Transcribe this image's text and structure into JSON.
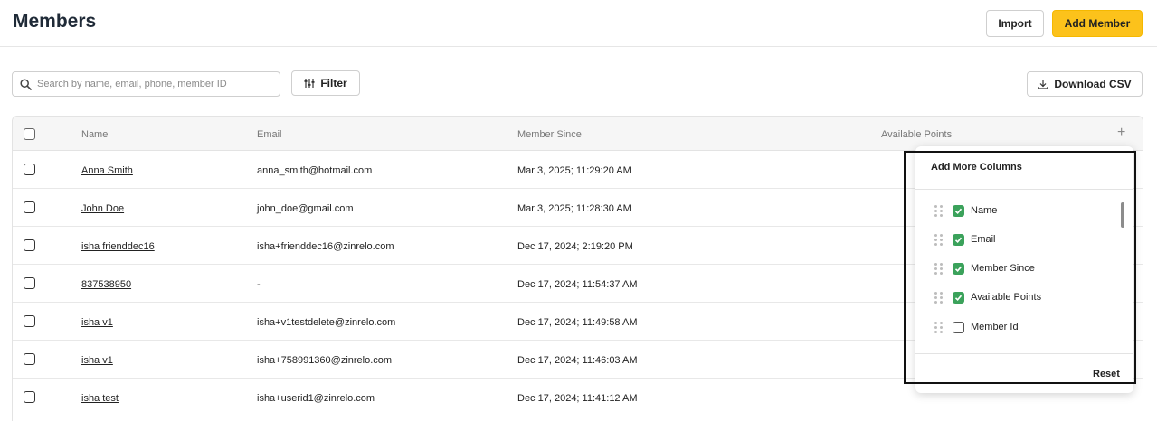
{
  "header": {
    "title": "Members",
    "import_label": "Import",
    "add_label": "Add Member"
  },
  "toolbar": {
    "search_placeholder": "Search by name, email, phone, member ID",
    "filter_label": "Filter",
    "download_label": "Download CSV"
  },
  "table": {
    "columns": {
      "name": "Name",
      "email": "Email",
      "member_since": "Member Since",
      "points": "Available Points",
      "add": "+"
    },
    "rows": [
      {
        "name": "Anna Smith",
        "email": "anna_smith@hotmail.com",
        "since": "Mar 3, 2025; 11:29:20 AM"
      },
      {
        "name": "John Doe",
        "email": "john_doe@gmail.com",
        "since": "Mar 3, 2025; 11:28:30 AM"
      },
      {
        "name": "isha frienddec16",
        "email": "isha+frienddec16@zinrelo.com",
        "since": "Dec 17, 2024; 2:19:20 PM"
      },
      {
        "name": "837538950",
        "email": "-",
        "since": "Dec 17, 2024; 11:54:37 AM"
      },
      {
        "name": "isha v1",
        "email": "isha+v1testdelete@zinrelo.com",
        "since": "Dec 17, 2024; 11:49:58 AM"
      },
      {
        "name": "isha v1",
        "email": "isha+758991360@zinrelo.com",
        "since": "Dec 17, 2024; 11:46:03 AM"
      },
      {
        "name": "isha test",
        "email": "isha+userid1@zinrelo.com",
        "since": "Dec 17, 2024; 11:41:12 AM"
      }
    ]
  },
  "column_popup": {
    "title": "Add More Columns",
    "options": [
      {
        "label": "Name",
        "checked": true
      },
      {
        "label": "Email",
        "checked": true
      },
      {
        "label": "Member Since",
        "checked": true
      },
      {
        "label": "Available Points",
        "checked": true
      },
      {
        "label": "Member Id",
        "checked": false
      }
    ],
    "reset_label": "Reset"
  },
  "colors": {
    "accent": "#fcc21b",
    "checkbox_on": "#3ba25b"
  }
}
